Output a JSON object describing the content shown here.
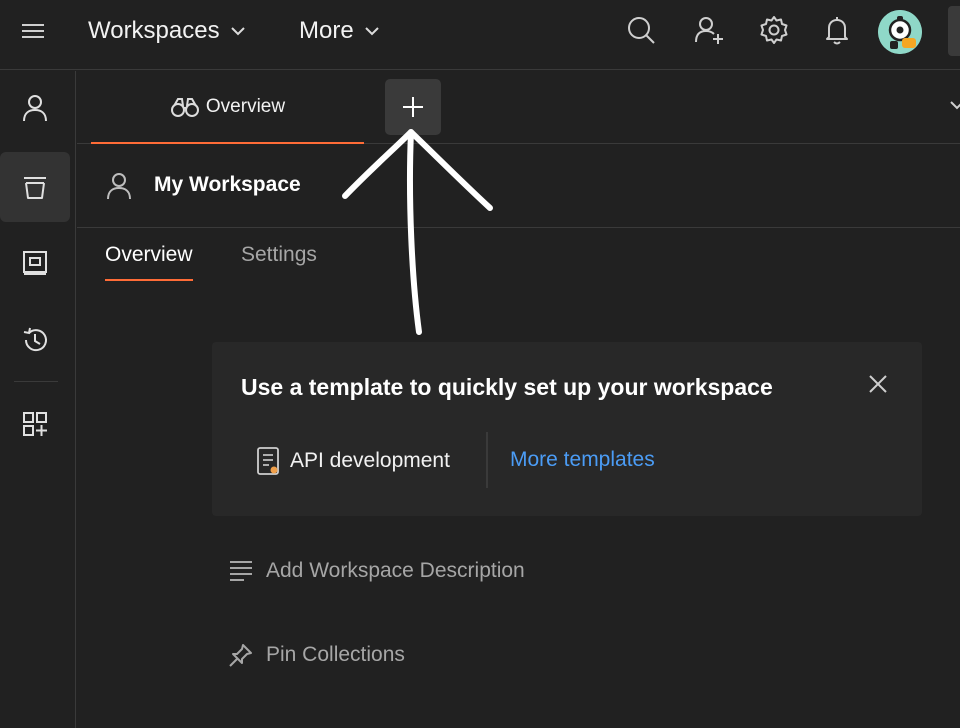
{
  "topbar": {
    "workspaces_label": "Workspaces",
    "more_label": "More",
    "icons": [
      "menu-icon",
      "search-icon",
      "invite-user-icon",
      "settings-gear-icon",
      "notification-bell-icon",
      "avatar"
    ]
  },
  "sidebar": {
    "items": [
      {
        "icon": "user-icon",
        "active": false
      },
      {
        "icon": "collections-trash-icon",
        "active": true
      },
      {
        "icon": "environments-icon",
        "active": false
      },
      {
        "icon": "history-icon",
        "active": false
      },
      {
        "icon": "add-apps-icon",
        "active": false
      }
    ]
  },
  "tabs": {
    "open": [
      {
        "label": "Overview",
        "icon": "binoculars-icon"
      }
    ],
    "new_tab_icon": "plus-icon"
  },
  "workspace": {
    "title": "My Workspace",
    "subtabs": [
      {
        "label": "Overview",
        "active": true
      },
      {
        "label": "Settings",
        "active": false
      }
    ]
  },
  "template_card": {
    "title": "Use a template to quickly set up your workspace",
    "option_label": "API development",
    "more_label": "More templates"
  },
  "actions": {
    "add_description": "Add Workspace Description",
    "pin_collections": "Pin Collections"
  },
  "colors": {
    "background": "#212121",
    "accent": "#ff6c37",
    "link": "#4b9cf5",
    "muted_text": "#a6a6a6"
  }
}
